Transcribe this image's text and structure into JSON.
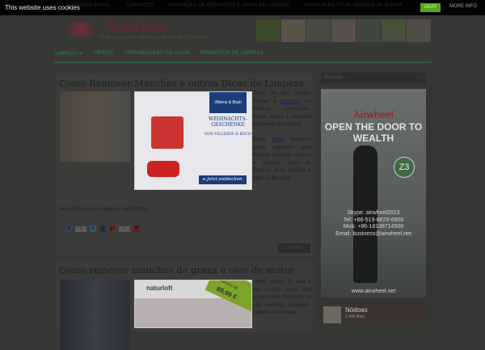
{
  "cookie_bar": {
    "message": "This website uses cookies",
    "okay": "OKAY",
    "more_info": "MORE INFO"
  },
  "top_nav": [
    "PÁGINA INICIAL",
    "CONTACTO",
    "AVALIAÇÃO DE PRODUTOS E DICAS DE LIMPEZA",
    "DICAS PARA TIRAR NÓDOAS DE ROUPA"
  ],
  "header": {
    "title": "Nódoas",
    "subtitle": "O blogue com todas as dicas de Limpeza!"
  },
  "main_nav": [
    "LIMPEZA ▾",
    "VÍDEOS",
    "ORGANIZAÇÃO DA CASA",
    "PRODUTOS DE LIMPEZA"
  ],
  "posts": [
    {
      "title": "Como Remover Manchas e outras Dicas de Limpeza",
      "text_a": "Todos os dias surgem nódoas e ",
      "link_a": "manchas",
      "text_b": " em diversas superfícies, desde tecidos e vestuário à bancada da cozinha.",
      "text_c": "Neste ",
      "link_b": "artigo",
      "text_d": " deixamos vários sugestões para remover manchas comuns e algumas dicas de limpeza, muito práticas e úteis no dia-a-dia.",
      "video_line": "Veja o vídeo que se segue e saiba como:",
      "share_counts": {
        "facebook": "3",
        "googleplus": "1"
      },
      "read_more": "LER MAIS...",
      "ad": {
        "brand": "Villeroy & Boch",
        "headline": "WEIHNACHTS-GESCHENKE",
        "sub": "VON VILLEROY & BOCH",
        "cta": "▸ Jetzt entdecken"
      }
    },
    {
      "title": "Como remover manchas de graxa e oleo de motor",
      "text_a": "Muitos objetos da casa e dos nossos carros têm graxa e óleo. Como tal, se não tivermos cuidadoso, podemos facilmente",
      "ad": {
        "brand": "naturloft",
        "price_label": "Vitrinen ab",
        "price": "89,99 €"
      }
    }
  ],
  "sidebar": {
    "search_placeholder": "Procurar...",
    "ad": {
      "brand": "Airwheel",
      "headline": "OPEN THE DOOR TO WEALTH",
      "model": "Z3",
      "skype": "Skype: airwheel2013",
      "tel": "Tel: +86-519-8829-6900",
      "mob": "Mob: +86-18138714500",
      "email": "Email: business@airwheel.net",
      "url": "www.airwheel.net"
    },
    "facebook": {
      "name": "Nódoas",
      "likes": "1.456 likes"
    }
  }
}
